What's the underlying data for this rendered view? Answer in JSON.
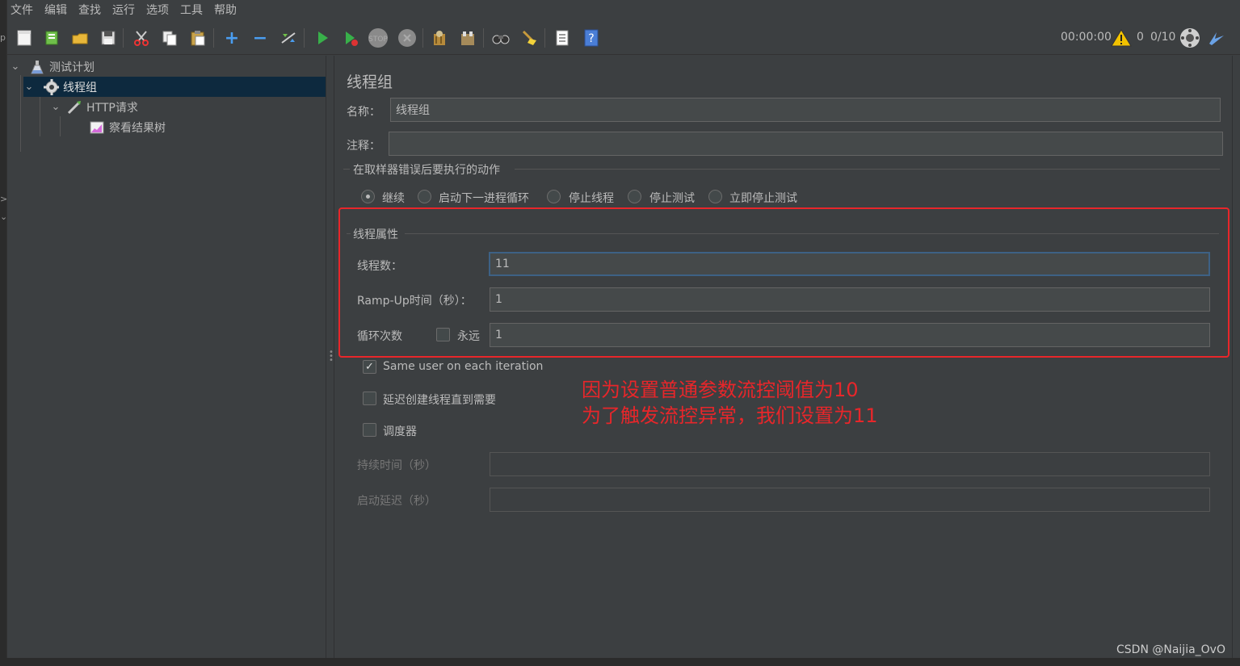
{
  "menu": [
    "文件",
    "编辑",
    "查找",
    "运行",
    "选项",
    "工具",
    "帮助"
  ],
  "toolbar": {
    "icons": [
      "new-icon",
      "templates-icon",
      "open-icon",
      "save-icon",
      "cut-icon",
      "copy-icon",
      "paste-icon",
      "expand-icon",
      "collapse-icon",
      "toggle-icon",
      "start-icon",
      "start-no-pause-icon",
      "stop-icon",
      "shutdown-icon",
      "clear-icon",
      "clear-all-icon",
      "search-icon",
      "reset-search-icon",
      "function-helper-icon",
      "help-icon"
    ],
    "timer": "00:00:00",
    "warning_count": "0",
    "threads": "0/10"
  },
  "tree": {
    "plan": "测试计划",
    "thread_group": "线程组",
    "http": "HTTP请求",
    "listener": "察看结果树"
  },
  "panel": {
    "title": "线程组",
    "name_label": "名称：",
    "name_value": "线程组",
    "comment_label": "注释：",
    "comment_value": "",
    "on_error_title": "在取样器错误后要执行的动作",
    "on_error_options": [
      "继续",
      "启动下一进程循环",
      "停止线程",
      "停止测试",
      "立即停止测试"
    ],
    "on_error_selected": 0,
    "props_title": "线程属性",
    "threads_label": "线程数：",
    "threads_value": "11",
    "rampup_label": "Ramp-Up时间（秒）：",
    "rampup_value": "1",
    "loop_label": "循环次数",
    "forever_label": "永远",
    "loop_value": "1",
    "same_user_label": "Same user on each iteration",
    "same_user_checked": true,
    "delay_label": "延迟创建线程直到需要",
    "scheduler_label": "调度器",
    "duration_label": "持续时间（秒）",
    "startup_delay_label": "启动延迟（秒）"
  },
  "annotation": {
    "line1": "因为设置普通参数流控阈值为10",
    "line2": "为了触发流控异常，我们设置为11",
    "color": "#e8262a"
  },
  "watermark": "CSDN @Naijia_OvO"
}
